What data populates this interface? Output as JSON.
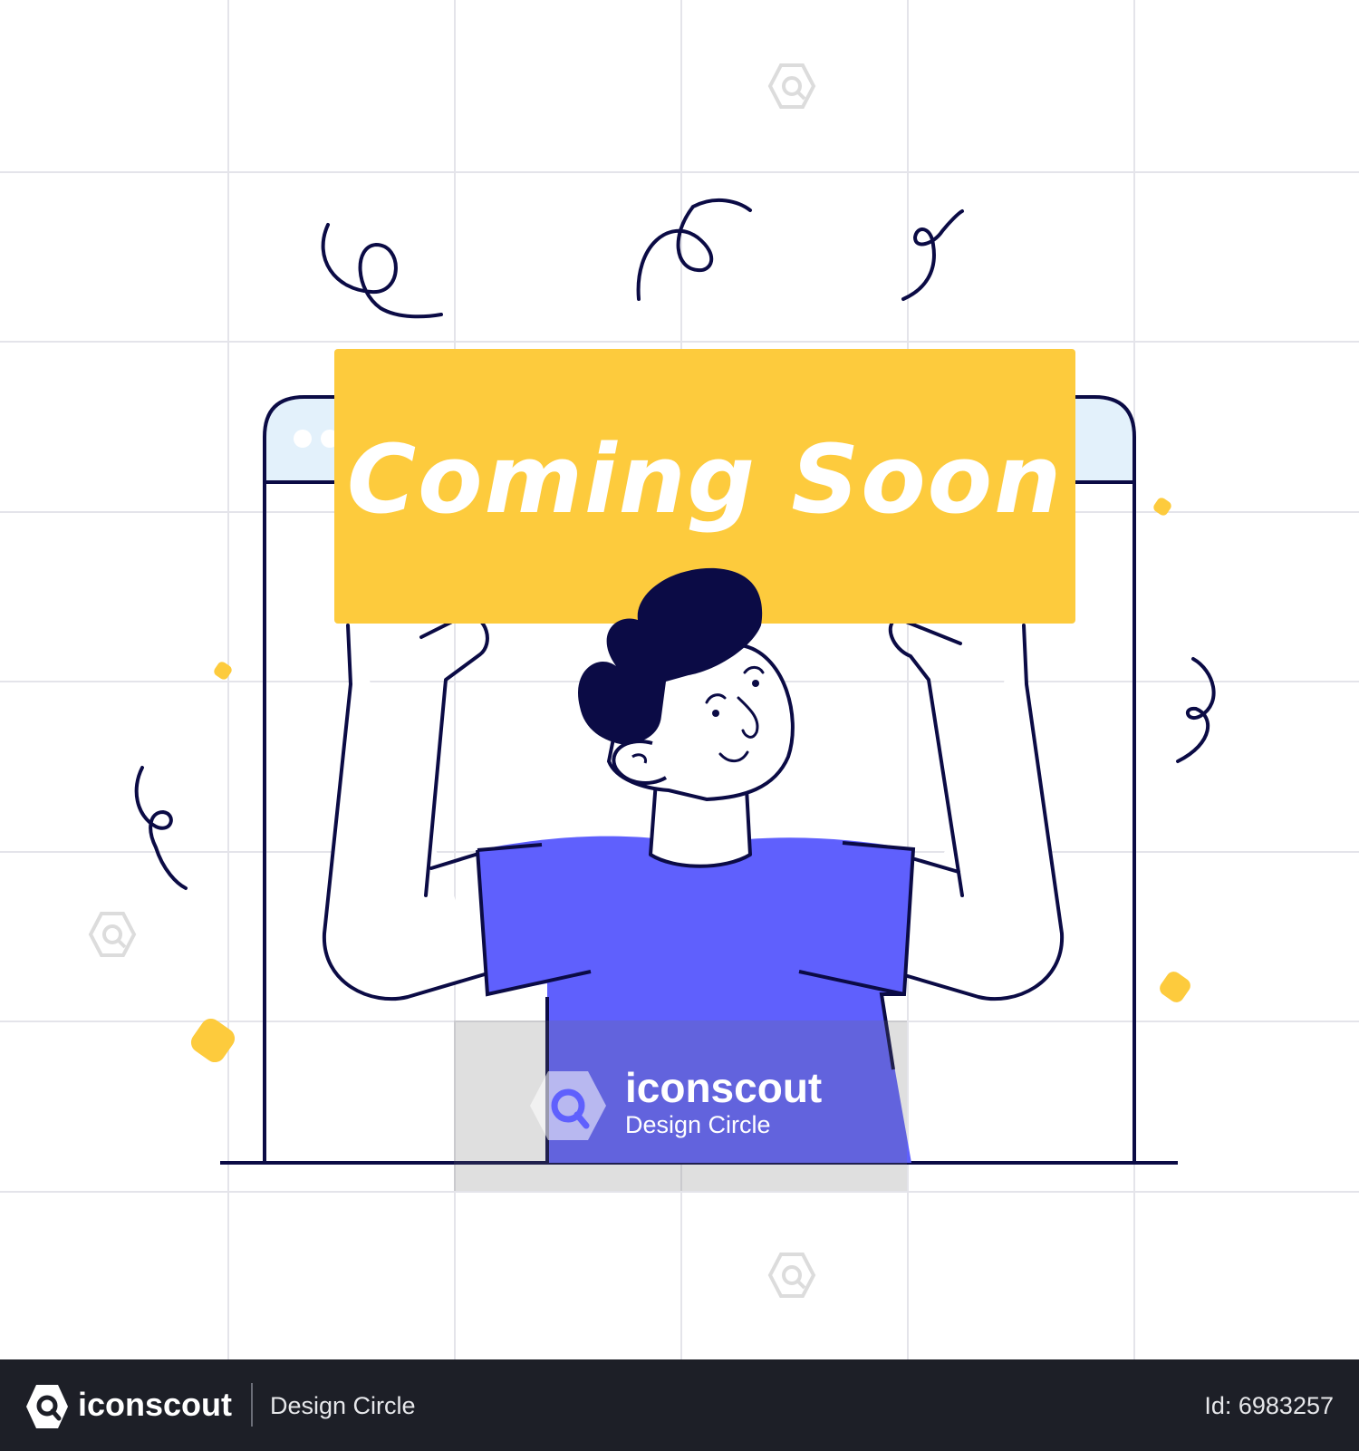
{
  "sign": {
    "text": "Coming Soon"
  },
  "watermark": {
    "brand": "iconscout",
    "creator": "Design Circle"
  },
  "footer": {
    "brand": "iconscout",
    "creator": "Design Circle",
    "asset_id": "Id: 6983257"
  },
  "colors": {
    "background": "#ffffff",
    "grid": "#e4e4ea",
    "outline": "#0b0b45",
    "sign": "#fdcb3d",
    "shirt": "#5f60fd",
    "hair": "#0b0b45",
    "browser_bar": "#e3f1fb",
    "footer": "#1d1f27"
  },
  "icons": [
    "search-watermark-icon",
    "iconscout-logo-icon"
  ]
}
